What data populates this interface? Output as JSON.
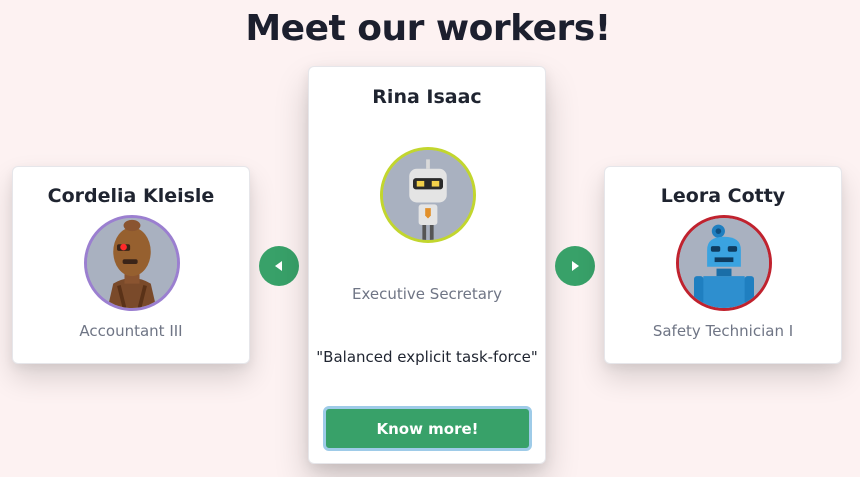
{
  "page": {
    "title": "Meet our workers!"
  },
  "carousel": {
    "prev_icon": "chevron-left-icon",
    "next_icon": "chevron-right-icon",
    "accent_color": "#38a169"
  },
  "workers": {
    "left": {
      "name": "Cordelia Kleisle",
      "role": "Accountant III",
      "avatar_icon": "robot-avatar-brown-icon",
      "ring_color": "#9b7fd0"
    },
    "center": {
      "name": "Rina Isaac",
      "role": "Executive Secretary",
      "quote": "\"Balanced explicit task-force\"",
      "avatar_icon": "robot-avatar-white-icon",
      "ring_color": "#c2d62e",
      "button_label": "Know more!"
    },
    "right": {
      "name": "Leora Cotty",
      "role": "Safety Technician I",
      "avatar_icon": "robot-avatar-blue-icon",
      "ring_color": "#c0222e"
    }
  }
}
